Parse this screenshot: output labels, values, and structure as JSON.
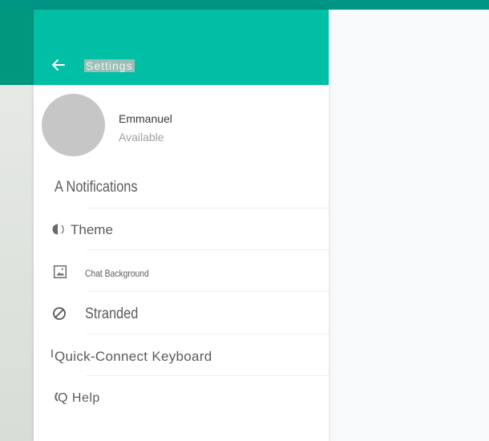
{
  "header": {
    "title": "Settings"
  },
  "profile": {
    "name": "Emmanuel",
    "status": "Available"
  },
  "menu": [
    {
      "label": "A Notifications",
      "icon": "notifications-icon"
    },
    {
      "label": "Theme",
      "icon": "theme-icon"
    },
    {
      "label": "Chat Background",
      "icon": "wallpaper-icon"
    },
    {
      "label": "Stranded",
      "icon": "blocked-icon"
    },
    {
      "label": "Quick-Connect Keyboard",
      "icon": "keyboard-icon"
    },
    {
      "label": "Q Help",
      "icon": "help-icon"
    }
  ],
  "colors": {
    "header": "#00bfa5",
    "topbar": "#00977f",
    "text": "#5b5b5b",
    "muted": "#a0a0a0"
  }
}
